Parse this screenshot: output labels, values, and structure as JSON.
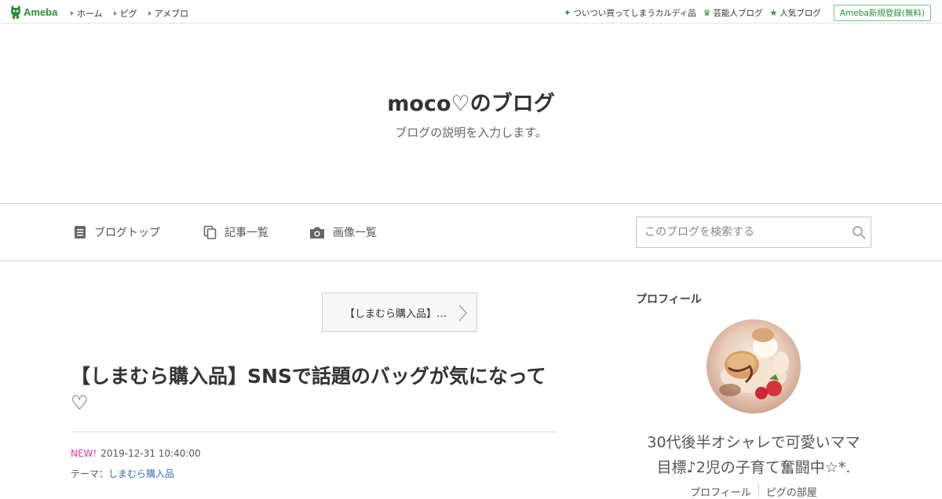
{
  "topbar": {
    "logo_text": "Ameba",
    "nav": [
      "ホーム",
      "ピグ",
      "アメブロ"
    ],
    "right_links": [
      {
        "icon": "sparkle-icon",
        "label": "ついつい買ってしまうカルディ品"
      },
      {
        "icon": "crown-icon",
        "label": "芸能人ブログ"
      },
      {
        "icon": "star-icon",
        "label": "人気ブログ"
      }
    ],
    "register_label": "Ameba新規登録(無料)"
  },
  "header": {
    "title": "moco♡のブログ",
    "description": "ブログの説明を入力します。"
  },
  "navbar": {
    "items": [
      {
        "icon": "document-icon",
        "label": "ブログトップ"
      },
      {
        "icon": "copy-icon",
        "label": "記事一覧"
      },
      {
        "icon": "camera-icon",
        "label": "画像一覧"
      }
    ],
    "search_placeholder": "このブログを検索する"
  },
  "main": {
    "theme_link": "【しまむら購入品】SNSで話題のバッグが気になって♡",
    "theme_link_display": "【しまむら購入品】…",
    "article_title": "【しまむら購入品】SNSで話題のバッグが気になって♡",
    "new_badge": "NEW!",
    "datetime": "2019-12-31 10:40:00",
    "theme_prefix": "テーマ：",
    "theme_name": "しまむら購入品"
  },
  "sidebar": {
    "heading": "プロフィール",
    "profile_line1": "30代後半オシャレで可愛いママ",
    "profile_line2": "目標♪2児の子育て奮闘中☆*.",
    "links": [
      "プロフィール",
      "ピグの部屋"
    ]
  },
  "colors": {
    "brand_green": "#2d8c3c",
    "new_pink": "#e4389a",
    "link_blue": "#3a6fb5"
  }
}
